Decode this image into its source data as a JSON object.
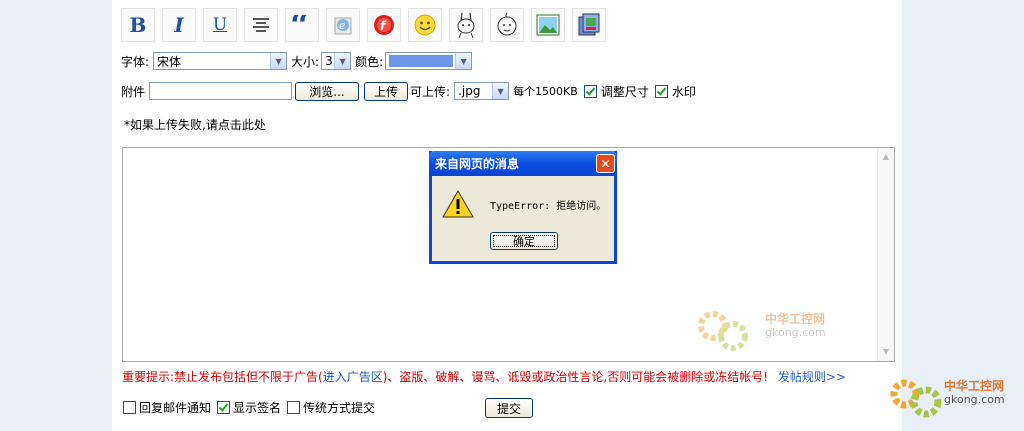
{
  "toolbar": {
    "bold": "B",
    "italic": "I",
    "underline": "U"
  },
  "format": {
    "font_label": "字体:",
    "font_value": "宋体",
    "size_label": "大小:",
    "size_value": "3",
    "color_label": "颜色:",
    "color_value": "#6f95e8"
  },
  "upload": {
    "attach_label": "附件",
    "browse_label": "浏览...",
    "upload_label": "上传",
    "allowed_label": "可上传:",
    "type_value": ".jpg",
    "limit_text": "每个1500KB",
    "resize_label": "调整尺寸",
    "watermark_label": "水印",
    "hint": "*如果上传失败,请点击此处"
  },
  "dialog": {
    "title": "来自网页的消息",
    "message": "TypeError: 拒绝访问。",
    "ok_label": "确定"
  },
  "notice": {
    "text_before": "重要提示:禁止发布包括但不限于广告(",
    "link_ad": "进入广告区",
    "text_after": ")、盗版、破解、谩骂、诋毁或政治性言论,否则可能会被删除或冻结帐号!",
    "rules_link": "发帖规则>>"
  },
  "options": {
    "reply_email": "回复邮件通知",
    "show_signature": "显示签名",
    "traditional_submit": "传统方式提交",
    "submit_label": "提交"
  },
  "watermarks": {
    "editor_cn": "中华工控网",
    "editor_en": "gkong.com",
    "corner_cn": "中华工控网",
    "corner_en": "gkong.com"
  }
}
